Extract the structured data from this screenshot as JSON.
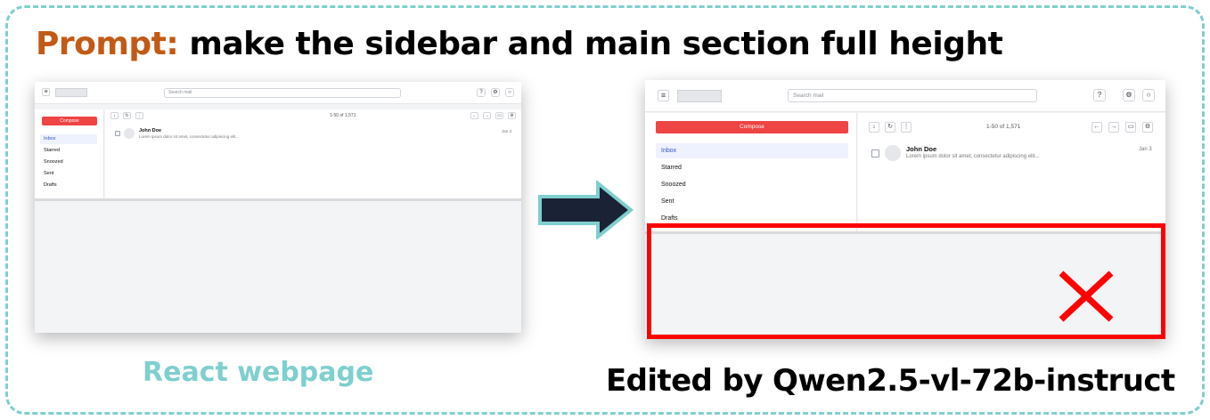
{
  "headline": {
    "label": "Prompt:",
    "text": "make the sidebar and main section full height"
  },
  "captions": {
    "left": "React webpage",
    "right": "Edited by Qwen2.5-vl-72b-instruct"
  },
  "colors": {
    "accent_orange": "#c25a16",
    "teal": "#7fcfcf",
    "compose_red": "#ef4444",
    "error_red": "#ff0000",
    "arrow_navy": "#1a2236"
  },
  "mock_app": {
    "search_placeholder": "Search mail",
    "compose_label": "Compose",
    "nav_items": [
      "Inbox",
      "Starred",
      "Snoozed",
      "Sent",
      "Drafts"
    ],
    "pagination": "1-50 of 1,571",
    "message": {
      "sender": "John Doe",
      "snippet": "Lorem ipsum dolor sit amet, consectetur adipiscing elit...",
      "date": "Jan 3"
    },
    "icons": {
      "header": [
        "menu-icon",
        "help-icon",
        "settings-icon",
        "account-icon"
      ],
      "toolbar_left": [
        "select-icon",
        "refresh-icon",
        "more-icon"
      ],
      "toolbar_right": [
        "prev-icon",
        "next-icon",
        "keyboard-icon",
        "settings-icon"
      ]
    }
  }
}
